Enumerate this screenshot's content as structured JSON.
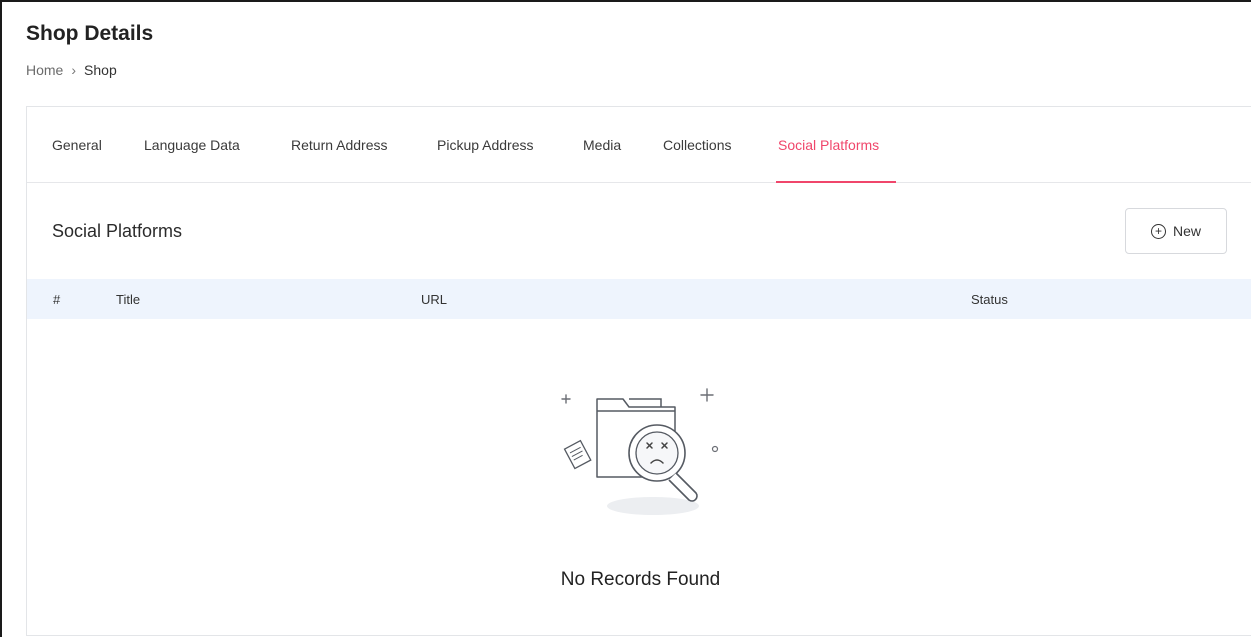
{
  "page": {
    "title": "Shop Details",
    "breadcrumb": {
      "home": "Home",
      "separator": "›",
      "current": "Shop"
    }
  },
  "tabs": [
    {
      "label": "General"
    },
    {
      "label": "Language Data"
    },
    {
      "label": "Return Address"
    },
    {
      "label": "Pickup Address"
    },
    {
      "label": "Media"
    },
    {
      "label": "Collections"
    },
    {
      "label": "Social Platforms",
      "active": true
    }
  ],
  "section": {
    "title": "Social Platforms",
    "new_button": {
      "icon": "plus-circle-icon",
      "label": "New"
    }
  },
  "table": {
    "columns": [
      "#",
      "Title",
      "URL",
      "Status"
    ]
  },
  "empty_state": {
    "icon": "no-records-illustration",
    "message": "No Records Found"
  },
  "colors": {
    "accent": "#f0466b",
    "table_header_bg": "#eef4fd",
    "border": "#e3e5e8"
  }
}
